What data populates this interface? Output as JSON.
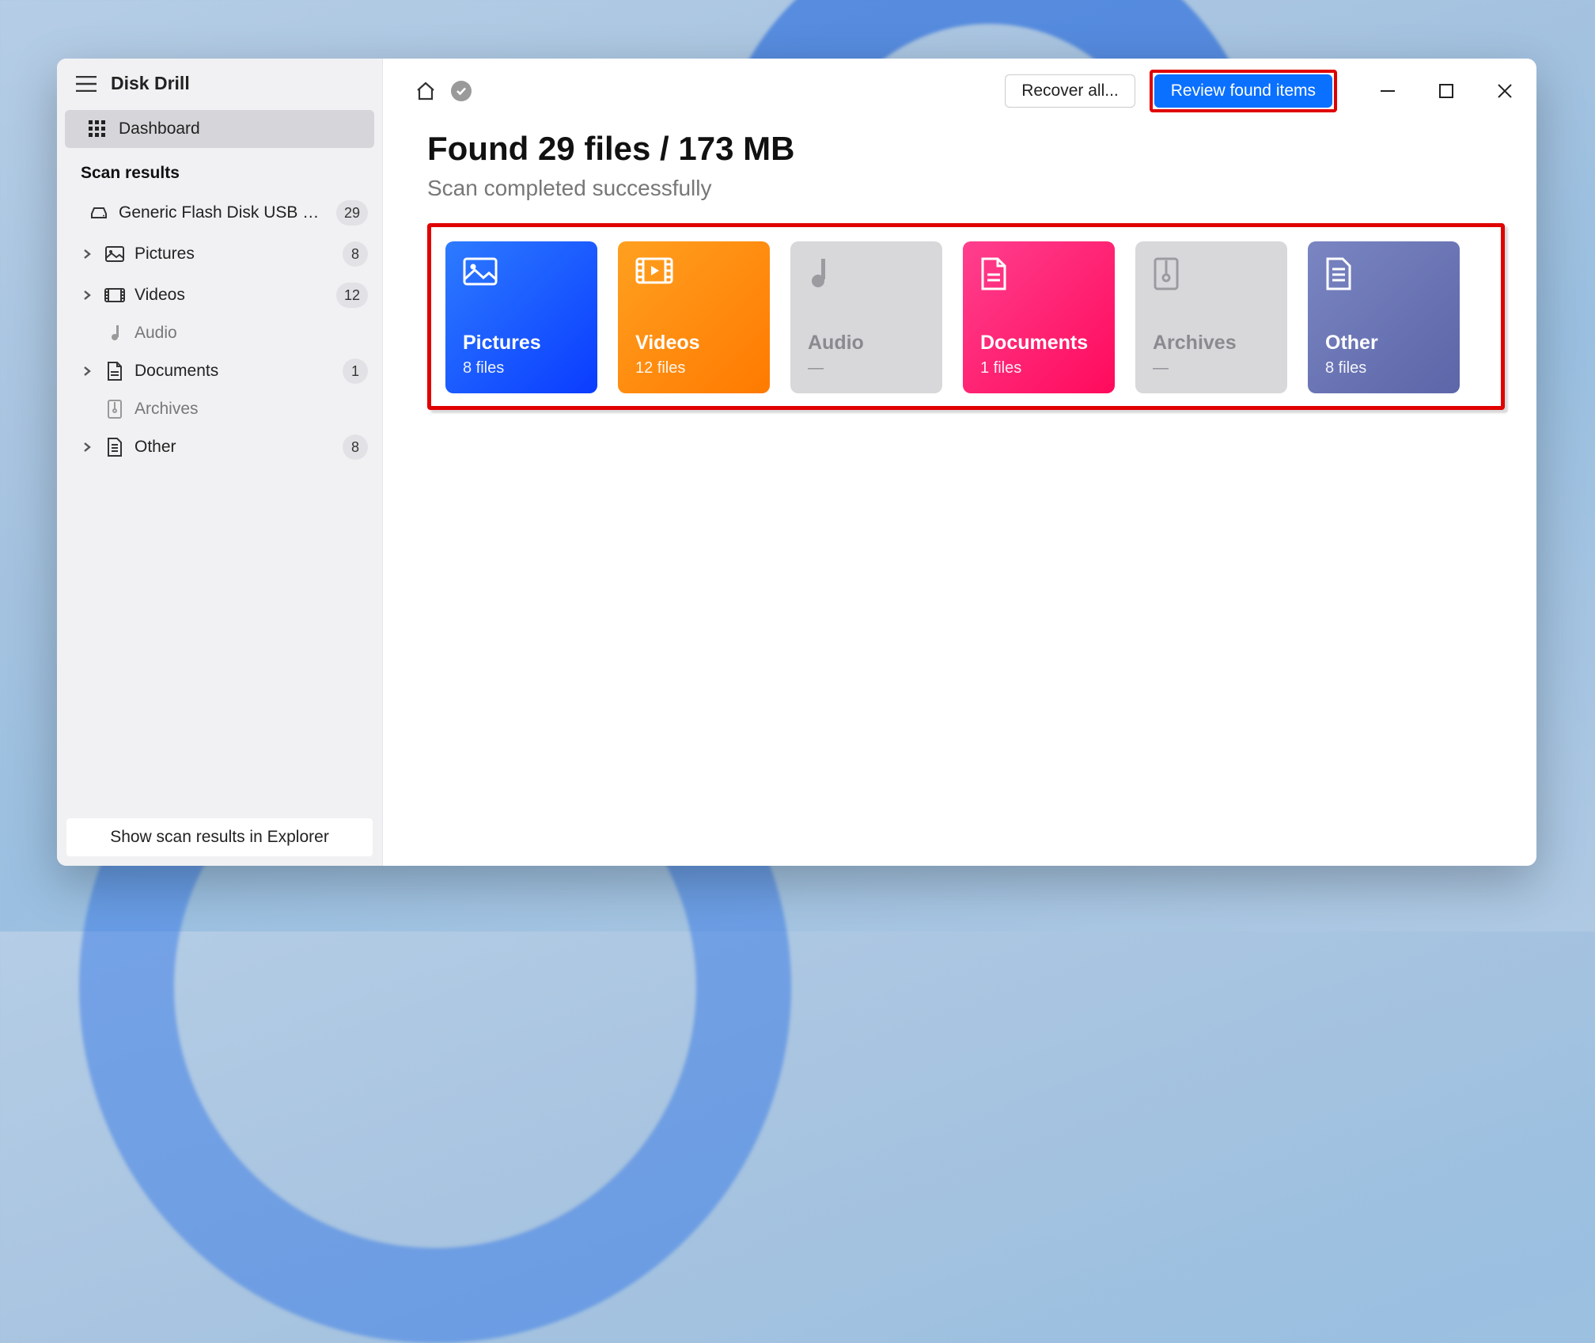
{
  "app": {
    "title": "Disk Drill"
  },
  "sidebar": {
    "dashboard_label": "Dashboard",
    "scan_results_label": "Scan results",
    "device": {
      "label": "Generic Flash Disk USB D…",
      "count": "29"
    },
    "items": [
      {
        "label": "Pictures",
        "count": "8",
        "icon": "picture",
        "muted": false,
        "expandable": true
      },
      {
        "label": "Videos",
        "count": "12",
        "icon": "video",
        "muted": false,
        "expandable": true
      },
      {
        "label": "Audio",
        "count": "",
        "icon": "audio",
        "muted": true,
        "expandable": false
      },
      {
        "label": "Documents",
        "count": "1",
        "icon": "document",
        "muted": false,
        "expandable": true
      },
      {
        "label": "Archives",
        "count": "",
        "icon": "archive",
        "muted": true,
        "expandable": false
      },
      {
        "label": "Other",
        "count": "8",
        "icon": "other",
        "muted": false,
        "expandable": true
      }
    ],
    "footer_button": "Show scan results in Explorer"
  },
  "topbar": {
    "recover_all_label": "Recover all...",
    "review_label": "Review found items"
  },
  "main": {
    "heading": "Found 29 files / 173 MB",
    "subheading": "Scan completed successfully",
    "cards": [
      {
        "title": "Pictures",
        "sub": "8 files",
        "class": "pictures",
        "icon": "picture"
      },
      {
        "title": "Videos",
        "sub": "12 files",
        "class": "videos",
        "icon": "video"
      },
      {
        "title": "Audio",
        "sub": "—",
        "class": "audio",
        "icon": "audio"
      },
      {
        "title": "Documents",
        "sub": "1 files",
        "class": "documents",
        "icon": "document"
      },
      {
        "title": "Archives",
        "sub": "—",
        "class": "archives",
        "icon": "archive"
      },
      {
        "title": "Other",
        "sub": "8 files",
        "class": "other",
        "icon": "other"
      }
    ]
  }
}
